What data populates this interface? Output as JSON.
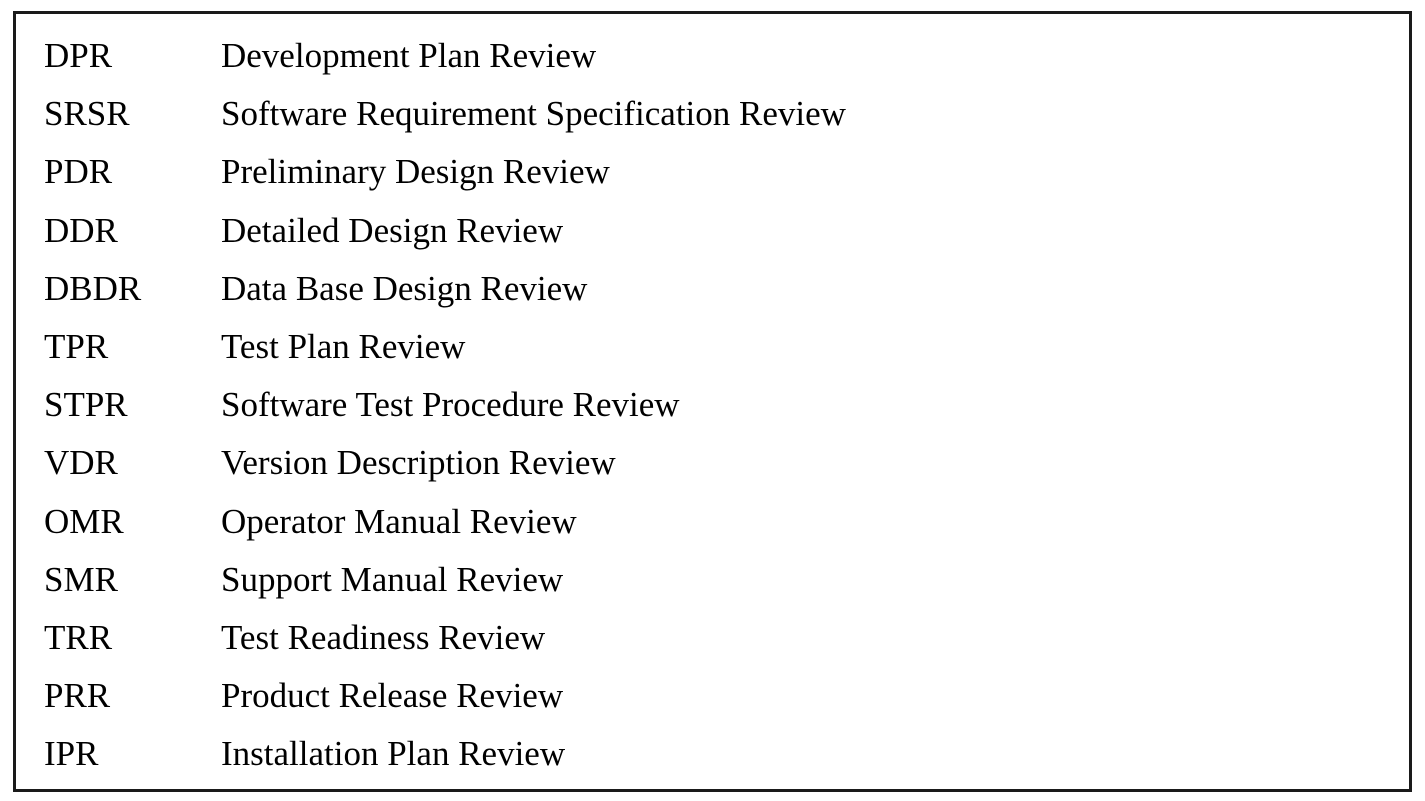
{
  "rows": [
    {
      "abbr": "DPR",
      "text": "Development Plan Review"
    },
    {
      "abbr": "SRSR",
      "text": "Software Requirement Specification Review"
    },
    {
      "abbr": "PDR",
      "text": "Preliminary Design Review"
    },
    {
      "abbr": "DDR",
      "text": "Detailed Design Review"
    },
    {
      "abbr": "DBDR",
      "text": "Data Base Design Review"
    },
    {
      "abbr": "TPR",
      "text": "Test Plan Review"
    },
    {
      "abbr": "STPR",
      "text": "Software Test Procedure Review"
    },
    {
      "abbr": "VDR",
      "text": "Version Description Review"
    },
    {
      "abbr": "OMR",
      "text": "Operator Manual Review"
    },
    {
      "abbr": "SMR",
      "text": "Support Manual Review"
    },
    {
      "abbr": "TRR",
      "text": "Test Readiness Review"
    },
    {
      "abbr": "PRR",
      "text": "Product Release Review"
    },
    {
      "abbr": "IPR",
      "text": "Installation Plan Review"
    }
  ]
}
